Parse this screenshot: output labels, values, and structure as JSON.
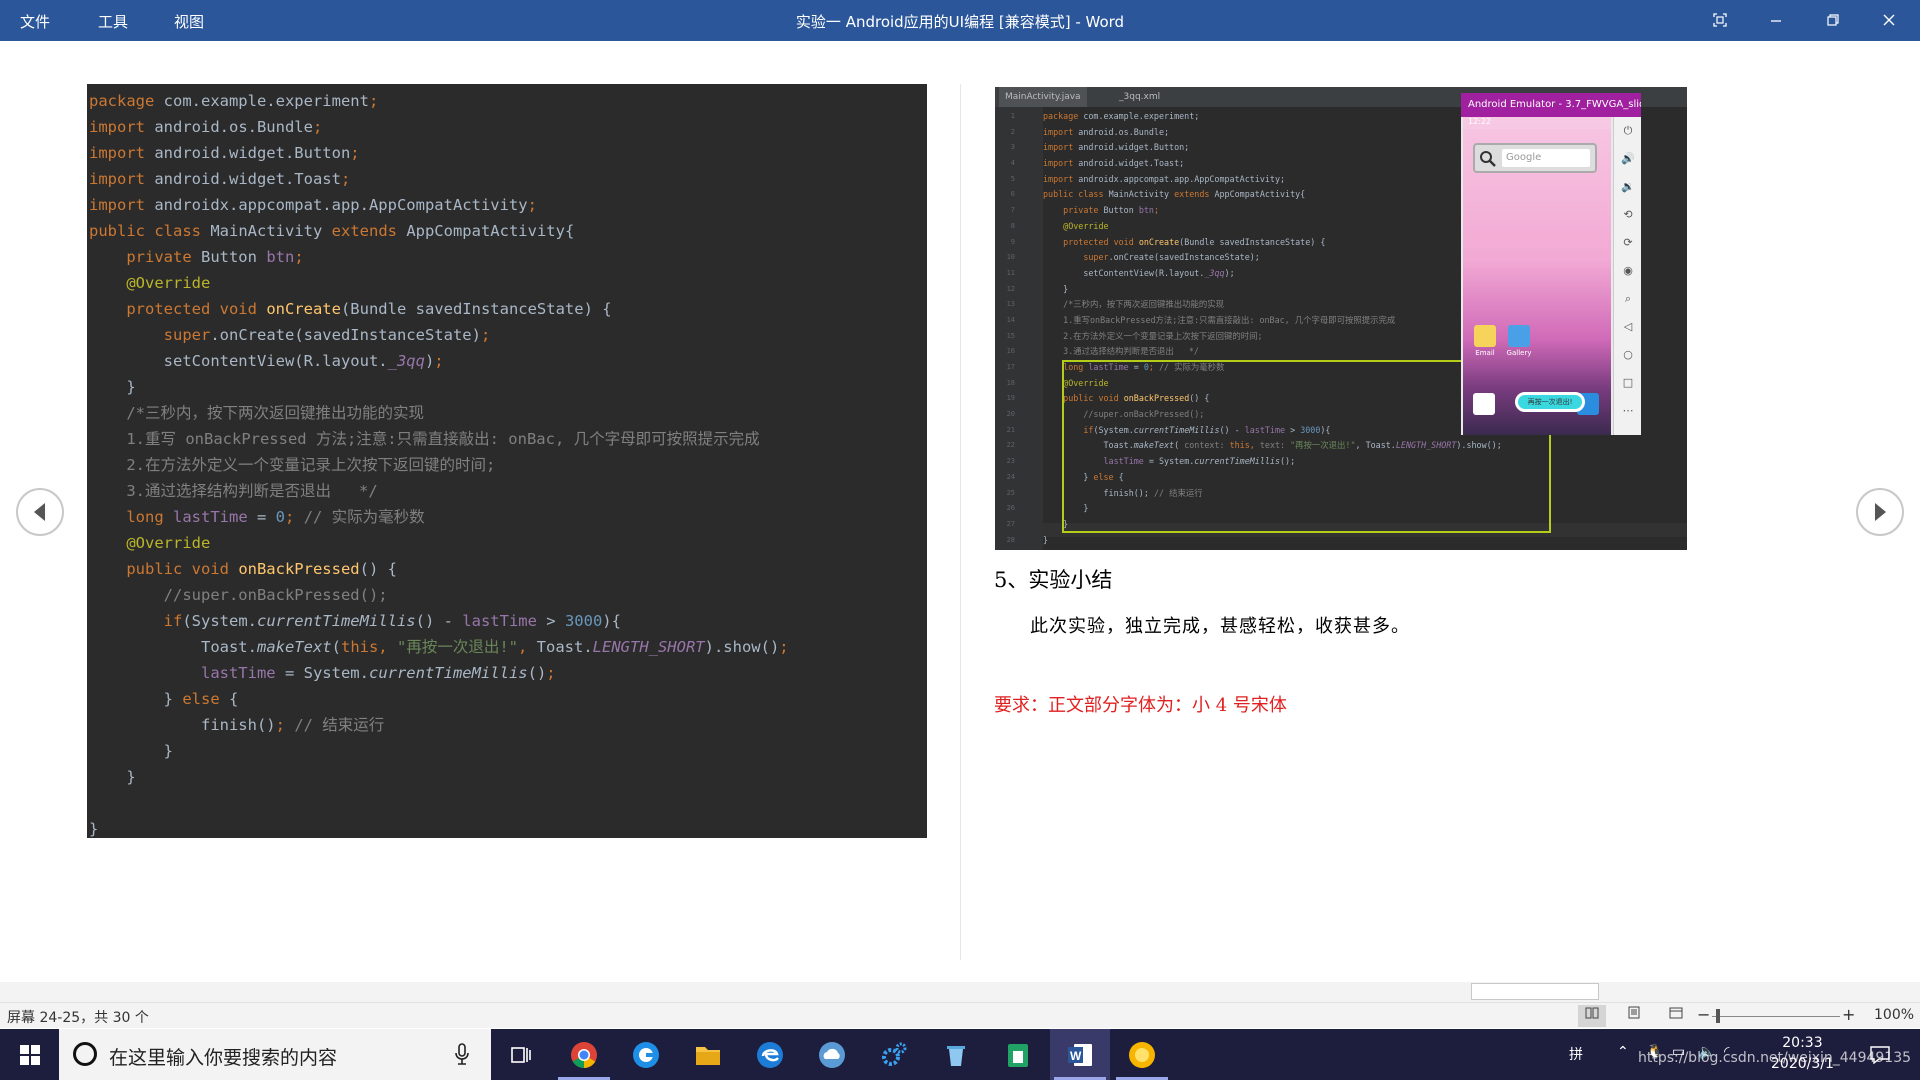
{
  "window": {
    "title": "实验一 Android应用的UI编程 [兼容模式] - Word",
    "menu": [
      "文件",
      "工具",
      "视图"
    ]
  },
  "left_code": [
    [
      [
        "kw",
        "package "
      ],
      [
        "txt",
        "com.example.experiment"
      ],
      [
        "kw",
        ";"
      ]
    ],
    [
      [
        "kw",
        "import "
      ],
      [
        "txt",
        "android.os.Bundle"
      ],
      [
        "kw",
        ";"
      ]
    ],
    [
      [
        "kw",
        "import "
      ],
      [
        "txt",
        "android.widget.Button"
      ],
      [
        "kw",
        ";"
      ]
    ],
    [
      [
        "kw",
        "import "
      ],
      [
        "txt",
        "android.widget.Toast"
      ],
      [
        "kw",
        ";"
      ]
    ],
    [
      [
        "kw",
        "import "
      ],
      [
        "txt",
        "androidx.appcompat.app.AppCompatActivity"
      ],
      [
        "kw",
        ";"
      ]
    ],
    [
      [
        "kw",
        "public class "
      ],
      [
        "txt",
        "MainActivity "
      ],
      [
        "kw",
        "extends "
      ],
      [
        "txt",
        "AppCompatActivity{"
      ]
    ],
    [
      [
        "txt",
        "    "
      ],
      [
        "kw",
        "private "
      ],
      [
        "txt",
        "Button "
      ],
      [
        "fld",
        "btn"
      ],
      [
        "kw",
        ";"
      ]
    ],
    [
      [
        "txt",
        "    "
      ],
      [
        "ann",
        "@Override"
      ]
    ],
    [
      [
        "txt",
        "    "
      ],
      [
        "kw",
        "protected void "
      ],
      [
        "fn",
        "onCreate"
      ],
      [
        "txt",
        "(Bundle savedInstanceState) {"
      ]
    ],
    [
      [
        "txt",
        "        "
      ],
      [
        "kw",
        "super"
      ],
      [
        "txt",
        ".onCreate(savedInstanceState)"
      ],
      [
        "kw",
        ";"
      ]
    ],
    [
      [
        "txt",
        "        setContentView(R.layout."
      ],
      [
        "fld ital",
        "_3qq"
      ],
      [
        "txt",
        ")"
      ],
      [
        "kw",
        ";"
      ]
    ],
    [
      [
        "txt",
        "    }"
      ]
    ],
    [
      [
        "cm",
        "    /*三秒内，按下两次返回键推出功能的实现"
      ]
    ],
    [
      [
        "cm",
        "    1.重写 onBackPressed 方法;注意:只需直接敲出: onBac, 几个字母即可按照提示完成"
      ]
    ],
    [
      [
        "cm",
        "    2.在方法外定义一个变量记录上次按下返回键的时间;"
      ]
    ],
    [
      [
        "cm",
        "    3.通过选择结构判断是否退出   */"
      ]
    ],
    [
      [
        "txt",
        "    "
      ],
      [
        "kw",
        "long "
      ],
      [
        "fld",
        "lastTime "
      ],
      [
        "txt",
        "= "
      ],
      [
        "num",
        "0"
      ],
      [
        "kw",
        "; "
      ],
      [
        "cm",
        "// 实际为毫秒数"
      ]
    ],
    [
      [
        "txt",
        "    "
      ],
      [
        "ann",
        "@Override"
      ]
    ],
    [
      [
        "txt",
        "    "
      ],
      [
        "kw",
        "public void "
      ],
      [
        "fn",
        "onBackPressed"
      ],
      [
        "txt",
        "() {"
      ]
    ],
    [
      [
        "cm",
        "        //super.onBackPressed();"
      ]
    ],
    [
      [
        "txt",
        "        "
      ],
      [
        "kw",
        "if"
      ],
      [
        "txt",
        "(System."
      ],
      [
        "txt ital",
        "currentTimeMillis"
      ],
      [
        "txt",
        "() - "
      ],
      [
        "fld",
        "lastTime "
      ],
      [
        "txt",
        "> "
      ],
      [
        "num",
        "3000"
      ],
      [
        "txt",
        ")"
      ],
      [
        "kw",
        ""
      ],
      [
        "txt",
        "{"
      ]
    ],
    [
      [
        "txt",
        "            Toast."
      ],
      [
        "txt ital",
        "makeText"
      ],
      [
        "txt",
        "("
      ],
      [
        "kw",
        "this, "
      ],
      [
        "str",
        "\"再按一次退出!\""
      ],
      [
        "kw",
        ", "
      ],
      [
        "txt",
        "Toast."
      ],
      [
        "fld ital",
        "LENGTH_SHORT"
      ],
      [
        "txt",
        ").show()"
      ],
      [
        "kw",
        ";"
      ]
    ],
    [
      [
        "txt",
        "            "
      ],
      [
        "fld",
        "lastTime "
      ],
      [
        "txt",
        "= System."
      ],
      [
        "txt ital",
        "currentTimeMillis"
      ],
      [
        "txt",
        "()"
      ],
      [
        "kw",
        ";"
      ]
    ],
    [
      [
        "txt",
        "        } "
      ],
      [
        "kw",
        "else "
      ],
      [
        "txt",
        "{"
      ]
    ],
    [
      [
        "txt",
        "            finish()"
      ],
      [
        "kw",
        "; "
      ],
      [
        "cm",
        "// 结束运行"
      ]
    ],
    [
      [
        "txt",
        "        }"
      ]
    ],
    [
      [
        "txt",
        "    }"
      ]
    ],
    [
      [
        "txt",
        ""
      ]
    ],
    [
      [
        "txt",
        "}"
      ]
    ]
  ],
  "ide": {
    "tabs": [
      "MainActivity.java",
      "_3qq.xml"
    ],
    "line_numbers": [
      "1",
      "2",
      "3",
      "4",
      "5",
      "6",
      "7",
      "8",
      "9",
      "10",
      "11",
      "12",
      "13",
      "14",
      "15",
      "16",
      "17",
      "18",
      "19",
      "20",
      "21",
      "22",
      "23",
      "24",
      "25",
      "26",
      "27",
      "28"
    ],
    "code": [
      [
        [
          "kw",
          "package "
        ],
        [
          "txt",
          "com.example.experiment;"
        ]
      ],
      [
        [
          "kw",
          "import "
        ],
        [
          "txt",
          "android.os.Bundle;"
        ]
      ],
      [
        [
          "kw",
          "import "
        ],
        [
          "txt",
          "android.widget.Button;"
        ]
      ],
      [
        [
          "kw",
          "import "
        ],
        [
          "txt",
          "android.widget.Toast;"
        ]
      ],
      [
        [
          "kw",
          "import "
        ],
        [
          "txt",
          "androidx.appcompat.app.AppCompatActivity;"
        ]
      ],
      [
        [
          "kw",
          "public class "
        ],
        [
          "txt",
          "MainActivity "
        ],
        [
          "kw",
          "extends "
        ],
        [
          "txt",
          "AppCompatActivity{"
        ]
      ],
      [
        [
          "txt",
          "    "
        ],
        [
          "kw",
          "private "
        ],
        [
          "txt",
          "Button "
        ],
        [
          "fld",
          "btn"
        ],
        [
          "kw",
          ";"
        ]
      ],
      [
        [
          "txt",
          "    "
        ],
        [
          "ann",
          "@Override"
        ]
      ],
      [
        [
          "txt",
          "    "
        ],
        [
          "kw",
          "protected void "
        ],
        [
          "fn",
          "onCreate"
        ],
        [
          "txt",
          "(Bundle savedInstanceState) {"
        ]
      ],
      [
        [
          "txt",
          "        "
        ],
        [
          "kw",
          "super"
        ],
        [
          "txt",
          ".onCreate(savedInstanceState);"
        ]
      ],
      [
        [
          "txt",
          "        setContentView(R.layout."
        ],
        [
          "fld ital",
          "_3qq"
        ],
        [
          "txt",
          ");"
        ]
      ],
      [
        [
          "txt",
          "    }"
        ]
      ],
      [
        [
          "cm",
          "    /*三秒内，按下两次返回键推出功能的实现"
        ]
      ],
      [
        [
          "cm",
          "    1.重写onBackPressed方法;注意:只需直接敲出: onBac, 几个字母即可按照提示完成"
        ]
      ],
      [
        [
          "cm",
          "    2.在方法外定义一个变量记录上次按下返回键的时间;"
        ]
      ],
      [
        [
          "cm",
          "    3.通过选择结构判断是否退出   */"
        ]
      ],
      [
        [
          "txt",
          "    "
        ],
        [
          "kw",
          "long "
        ],
        [
          "fld",
          "lastTime "
        ],
        [
          "txt",
          "= "
        ],
        [
          "num",
          "0"
        ],
        [
          "kw",
          "; "
        ],
        [
          "cm",
          "// 实际为毫秒数"
        ]
      ],
      [
        [
          "txt",
          "    "
        ],
        [
          "ann",
          "@Override"
        ]
      ],
      [
        [
          "txt",
          "    "
        ],
        [
          "kw",
          "public void "
        ],
        [
          "fn",
          "onBackPressed"
        ],
        [
          "txt",
          "() {"
        ]
      ],
      [
        [
          "cm",
          "        //super.onBackPressed();"
        ]
      ],
      [
        [
          "txt",
          "        "
        ],
        [
          "kw",
          "if"
        ],
        [
          "txt",
          "(System."
        ],
        [
          "txt ital",
          "currentTimeMillis"
        ],
        [
          "txt",
          "() - "
        ],
        [
          "fld",
          "lastTime "
        ],
        [
          "txt",
          "> "
        ],
        [
          "num",
          "3000"
        ],
        [
          "txt",
          "){"
        ]
      ],
      [
        [
          "txt",
          "            Toast."
        ],
        [
          "txt ital",
          "makeText"
        ],
        [
          "txt",
          "( "
        ],
        [
          "cm",
          "context: "
        ],
        [
          "kw",
          "this, "
        ],
        [
          "cm",
          "text: "
        ],
        [
          "str",
          "\"再按一次退出!\""
        ],
        [
          "txt",
          ", Toast."
        ],
        [
          "fld ital",
          "LENGTH_SHORT"
        ],
        [
          "txt",
          ").show();"
        ]
      ],
      [
        [
          "txt",
          "            "
        ],
        [
          "fld",
          "lastTime "
        ],
        [
          "txt",
          "= System."
        ],
        [
          "txt ital",
          "currentTimeMillis"
        ],
        [
          "txt",
          "();"
        ]
      ],
      [
        [
          "txt",
          "        } "
        ],
        [
          "kw",
          "else "
        ],
        [
          "txt",
          "{"
        ]
      ],
      [
        [
          "txt",
          "            finish(); "
        ],
        [
          "cm",
          "// 结束运行"
        ]
      ],
      [
        [
          "txt",
          "        }"
        ]
      ],
      [
        [
          "txt",
          "    }"
        ]
      ],
      [
        [
          "txt",
          "}"
        ]
      ]
    ]
  },
  "emulator": {
    "title": "Android Emulator - 3.7_FWVGA_slid...",
    "time": "12:22",
    "search_placeholder": "Google",
    "app_email": "Email",
    "app_gallery": "Gallery",
    "toast": "再按一次退出!"
  },
  "doc": {
    "heading": "5、实验小结",
    "summary": "此次实验，独立完成，甚感轻松，收获甚多。",
    "requirement": "要求：正文部分字体为：小 4 号宋体"
  },
  "statusbar": {
    "pages": "屏幕 24-25，共 30 个",
    "zoom": "100%"
  },
  "taskbar": {
    "search_placeholder": "在这里输入你要搜索的内容",
    "time": "20:33",
    "date": "2020/3/1",
    "watermark": "https://blog.csdn.net/weixin_44949135"
  },
  "colors": {
    "titlebar": "#2b579a",
    "code_bg": "#2b2b2b",
    "highlight_box": "#b5cc18",
    "requirement_text": "#e02020",
    "taskbar": "#1d1d3e"
  }
}
